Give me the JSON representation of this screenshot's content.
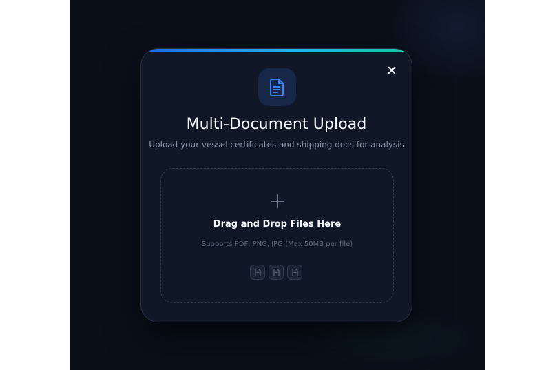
{
  "modal": {
    "title": "Multi-Document Upload",
    "subtitle": "Upload your vessel certificates and shipping docs for analysis",
    "header_icon": "document-icon",
    "close_icon": "close-icon"
  },
  "dropzone": {
    "icon": "plus-icon",
    "title": "Drag and Drop Files Here",
    "hint": "Supports PDF, PNG, JPG (Max 50MB per file)",
    "file_type_icons": [
      "file-icon",
      "file-icon",
      "file-icon"
    ]
  },
  "colors": {
    "backdrop": "#0a0f1a",
    "modal_bg": "#101828",
    "accent_start": "#2563eb",
    "accent_mid": "#22b3e6",
    "accent_end": "#14c8a0",
    "icon_blue": "#3b82f6",
    "text_primary": "#f5f7fb",
    "text_muted": "#8a94a6"
  }
}
